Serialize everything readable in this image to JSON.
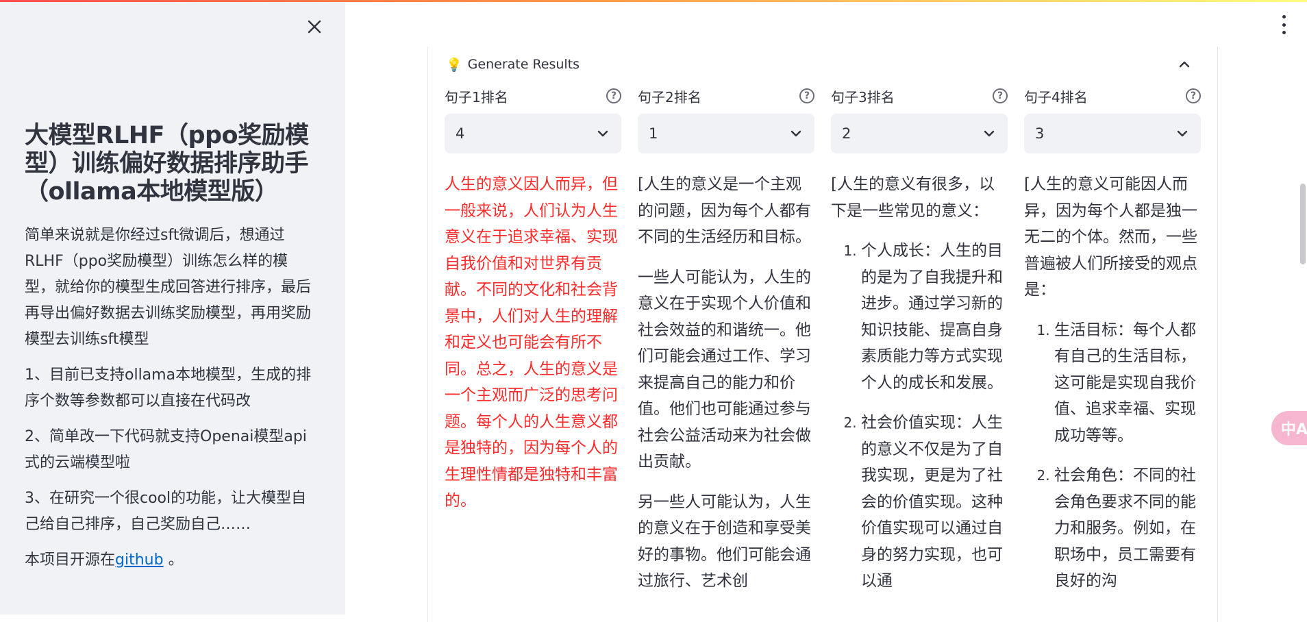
{
  "sidebar": {
    "title": "大模型RLHF（ppo奖励模型）训练偏好数据排序助手（ollama本地模型版）",
    "intro": "简单来说就是你经过sft微调后，想通过RLHF（ppo奖励模型）训练怎么样的模型，就给你的模型生成回答进行排序，最后再导出偏好数据去训练奖励模型，再用奖励模型去训练sft模型",
    "point1": "1、目前已支持ollama本地模型，生成的排序个数等参数都可以直接在代码改",
    "point2": "2、简单改一下代码就支持Openai模型api式的云端模型啦",
    "point3": "3、在研究一个很cool的功能，让大模型自己给自己排序，自己奖励自己……",
    "opensource_prefix": "本项目开源在",
    "opensource_link": "github",
    "opensource_suffix": " 。"
  },
  "panel": {
    "icon": "lightbulb-icon",
    "label": "Generate Results",
    "columns": [
      {
        "label": "句子1排名",
        "selected": "4",
        "color": "#ff2b2b",
        "paragraphs": [
          "人生的意义因人而异，但一般来说，人们认为人生意义在于追求幸福、实现自我价值和对世界有贡献。不同的文化和社会背景中，人们对人生的理解和定义也可能会有所不同。总之，人生的意义是一个主观而广泛的思考问题。每个人的人生意义都是独特的，因为每个人的生理性情都是独特和丰富的。"
        ]
      },
      {
        "label": "句子2排名",
        "selected": "1",
        "paragraphs": [
          "[人生的意义是一个主观的问题，因为每个人都有不同的生活经历和目标。",
          "一些人可能认为，人生的意义在于实现个人价值和社会效益的和谐统一。他们可能会通过工作、学习来提高自己的能力和价值。他们也可能通过参与社会公益活动来为社会做出贡献。",
          "另一些人可能认为，人生的意义在于创造和享受美好的事物。他们可能会通过旅行、艺术创"
        ]
      },
      {
        "label": "句子3排名",
        "selected": "2",
        "intro": "[人生的意义有很多，以下是一些常见的意义：",
        "list": [
          "个人成长：人生的目的是为了自我提升和进步。通过学习新的知识技能、提高自身素质能力等方式实现个人的成长和发展。",
          "社会价值实现：人生的意义不仅是为了自我实现，更是为了社会的价值实现。这种价值实现可以通过自身的努力实现，也可以通"
        ]
      },
      {
        "label": "句子4排名",
        "selected": "3",
        "intro": "[人生的意义可能因人而异，因为每个人都是独一无二的个体。然而，一些普遍被人们所接受的观点是：",
        "list": [
          "生活目标：每个人都有自己的生活目标，这可能是实现自我价值、追求幸福、实现成功等等。",
          "社会角色：不同的社会角色要求不同的能力和服务。例如，在职场中，员工需要有良好的沟"
        ]
      }
    ]
  },
  "translate_button": "中A"
}
